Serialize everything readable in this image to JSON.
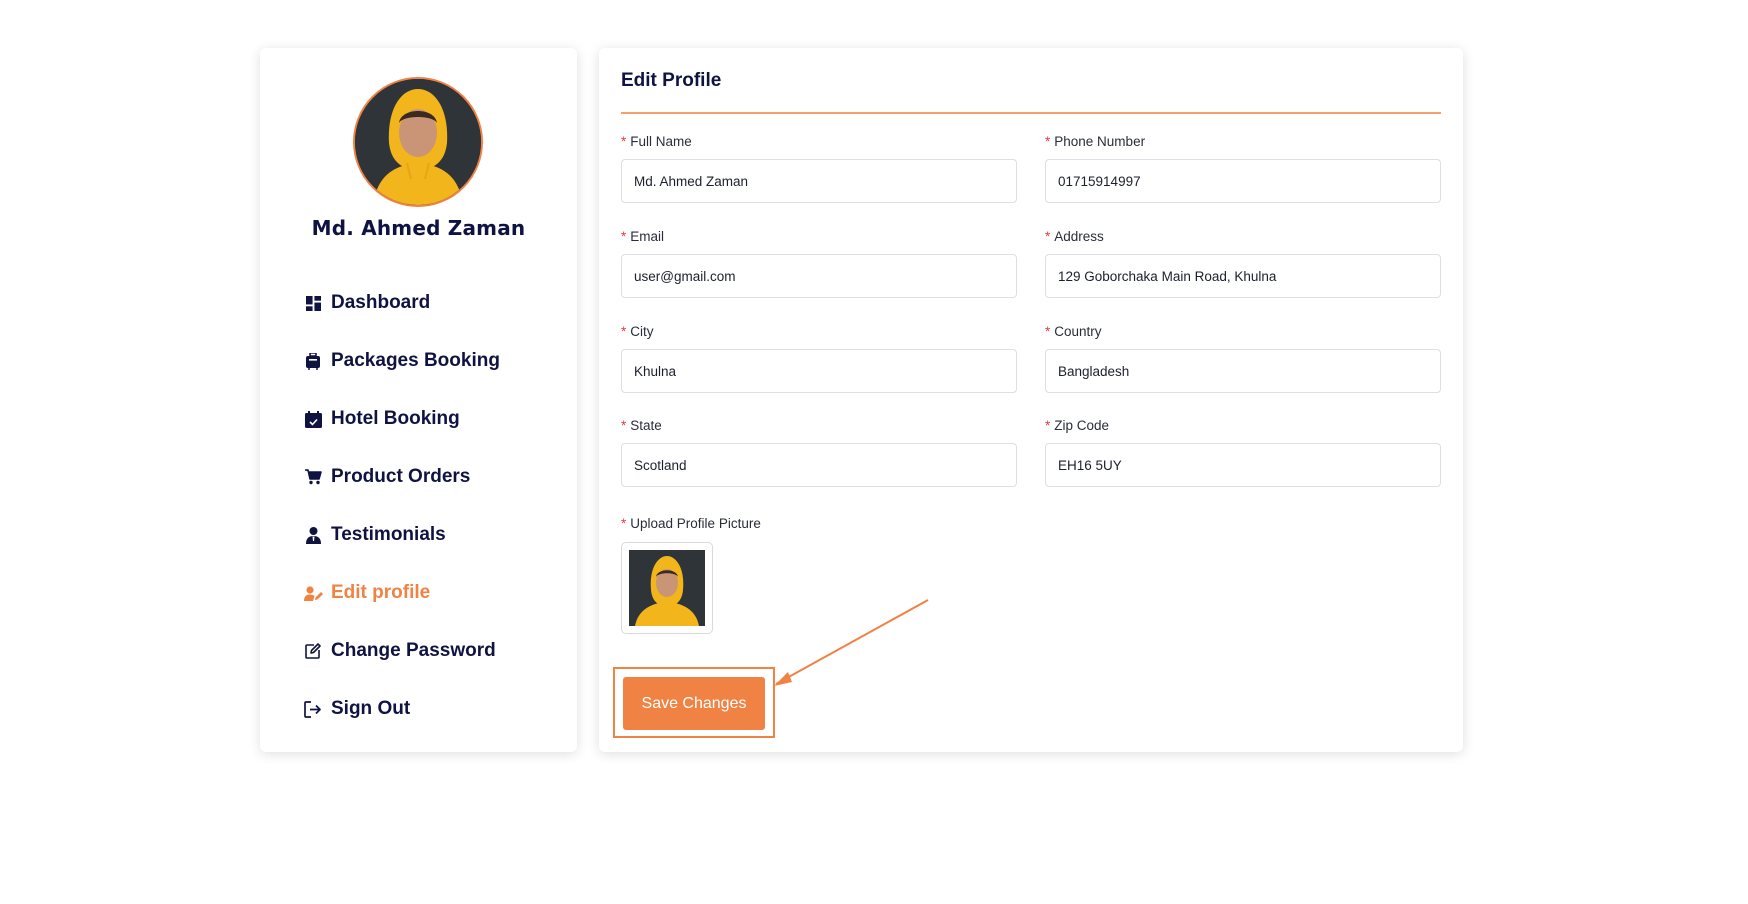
{
  "profile": {
    "name": "Md. Ahmed Zaman"
  },
  "sidebar": {
    "items": [
      {
        "label": "Dashboard",
        "icon": "dashboard-icon"
      },
      {
        "label": "Packages Booking",
        "icon": "luggage-icon"
      },
      {
        "label": "Hotel Booking",
        "icon": "calendar-check-icon"
      },
      {
        "label": "Product Orders",
        "icon": "cart-icon"
      },
      {
        "label": "Testimonials",
        "icon": "user-tie-icon"
      },
      {
        "label": "Edit profile",
        "icon": "user-edit-icon",
        "active": true
      },
      {
        "label": "Change Password",
        "icon": "pencil-square-icon"
      },
      {
        "label": "Sign Out",
        "icon": "sign-out-icon"
      }
    ]
  },
  "form": {
    "title": "Edit Profile",
    "required_mark": "*",
    "fields": {
      "full_name": {
        "label": "Full Name",
        "value": "Md. Ahmed Zaman"
      },
      "phone": {
        "label": "Phone Number",
        "value": "01715914997"
      },
      "email": {
        "label": "Email",
        "value": "user@gmail.com"
      },
      "address": {
        "label": "Address",
        "value": "129 Goborchaka Main Road, Khulna"
      },
      "city": {
        "label": "City",
        "value": "Khulna"
      },
      "country": {
        "label": "Country",
        "value": "Bangladesh"
      },
      "state": {
        "label": "State",
        "value": "Scotland"
      },
      "zip": {
        "label": "Zip Code",
        "value": "EH16 5UY"
      }
    },
    "upload_label": "Upload Profile Picture",
    "save_label": "Save Changes"
  },
  "colors": {
    "accent": "#f08244",
    "navy": "#0f1342",
    "required": "#e03c3c"
  }
}
